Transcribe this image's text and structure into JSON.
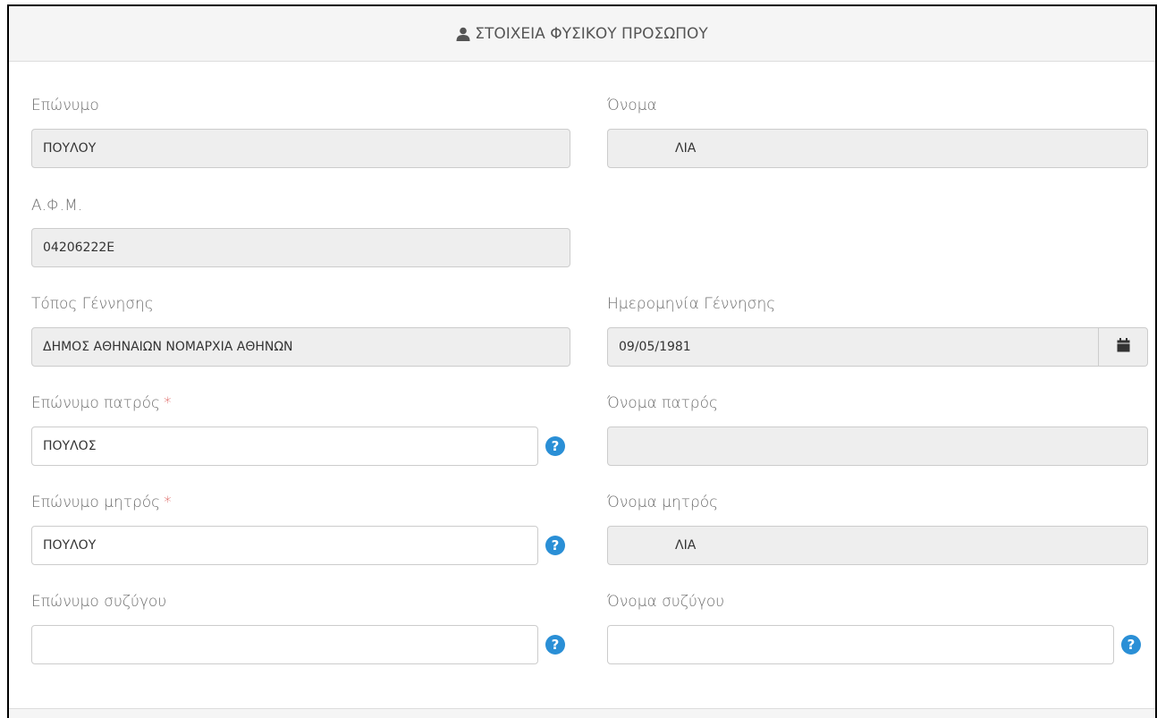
{
  "header": {
    "title": "ΣΤΟΙΧΕΙΑ ΦΥΣΙΚΟΥ ΠΡΟΣΩΠΟΥ",
    "icon": "user-icon"
  },
  "fields": {
    "surname": {
      "label": "Επώνυμο",
      "value": "ΠΟΥΛΟΥ"
    },
    "name": {
      "label": "Όνομα",
      "value": "ΛΙΑ"
    },
    "afm": {
      "label": "Α.Φ.Μ.",
      "value": "04206222E"
    },
    "birth_place": {
      "label": "Τόπος Γέννησης",
      "value": "ΔΗΜΟΣ ΑΘΗΝΑΙΩΝ ΝΟΜΑΡΧΙΑ ΑΘΗΝΩΝ"
    },
    "birth_date": {
      "label": "Ημερομηνία Γέννησης",
      "value": "09/05/1981",
      "icon": "calendar-icon"
    },
    "father_surname": {
      "label": "Επώνυμο πατρός",
      "required_mark": "*",
      "value": "ΠΟΥΛΟΣ",
      "help": "?"
    },
    "father_name": {
      "label": "Όνομα πατρός",
      "value": ""
    },
    "mother_surname": {
      "label": "Επώνυμο μητρός",
      "required_mark": "*",
      "value": "ΠΟΥΛΟΥ",
      "help": "?"
    },
    "mother_name": {
      "label": "Όνομα μητρός",
      "value": "ΛΙΑ"
    },
    "spouse_surname": {
      "label": "Επώνυμο συζύγου",
      "value": "",
      "help": "?"
    },
    "spouse_name": {
      "label": "Όνομα συζύγου",
      "value": "",
      "help": "?"
    }
  },
  "colors": {
    "help_icon": "#2a8fd6",
    "required": "#d9534f",
    "readonly_bg": "#eeeeee"
  }
}
